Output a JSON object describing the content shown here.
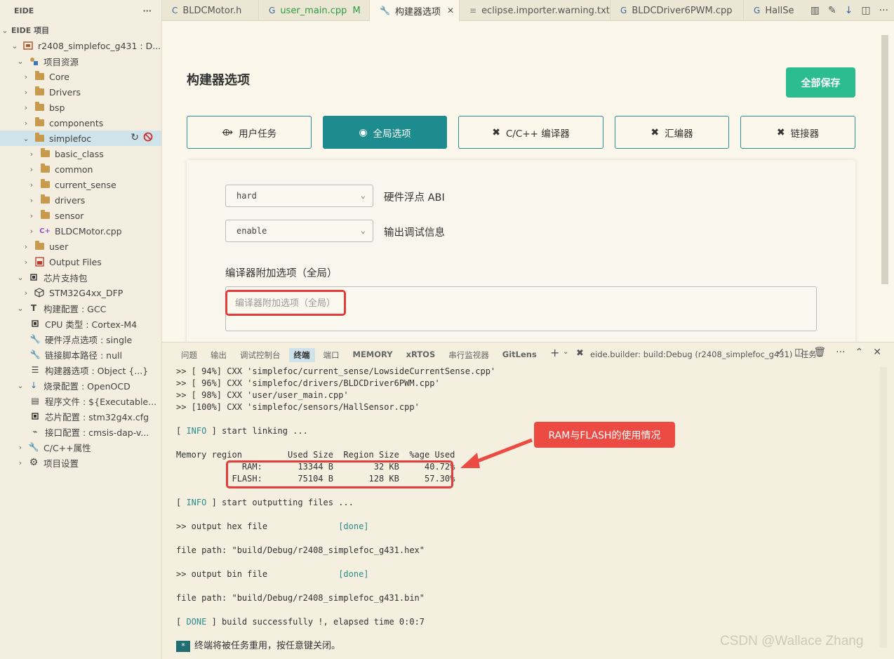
{
  "sidebar": {
    "title": "EIDE",
    "more": "···",
    "section": "EIDE 项目",
    "project_name": "r2408_simplefoc_g431 : D...",
    "resources": "项目资源",
    "folders": [
      "Core",
      "Drivers",
      "bsp",
      "components"
    ],
    "simplefoc": "simplefoc",
    "simplefoc_children": [
      "basic_class",
      "common",
      "current_sense",
      "drivers",
      "sensor"
    ],
    "bldc_file": "BLDCMotor.cpp",
    "user": "user",
    "output_files": "Output Files",
    "chip_pkg": "芯片支持包",
    "dfp": "STM32G4xx_DFP",
    "build_config": "构建配置 : GCC",
    "cpu_type": "CPU 类型 : Cortex-M4",
    "fpu": "硬件浮点选项 : single",
    "linker_script": "链接脚本路径 : null",
    "builder_options": "构建器选项 : Object {...}",
    "flash_config": "烧录配置 : OpenOCD",
    "program_file": "程序文件 : ${Executable...",
    "chip_config": "芯片配置 : stm32g4x.cfg",
    "interface_config": "接口配置 : cmsis-dap-v...",
    "cpp_props": "C/C++属性",
    "project_settings": "项目设置"
  },
  "tabs": [
    {
      "label": "BLDCMotor.h",
      "icon": "C",
      "active": false
    },
    {
      "label": "user_main.cpp",
      "icon": "G",
      "mod": "M",
      "active": false
    },
    {
      "label": "构建器选项",
      "icon": "wrench",
      "close": "✕",
      "active": true
    },
    {
      "label": "eclipse.importer.warning.txt",
      "icon": "≡",
      "active": false
    },
    {
      "label": "BLDCDriver6PWM.cpp",
      "icon": "G",
      "active": false
    },
    {
      "label": "HallSe",
      "icon": "G",
      "active": false
    }
  ],
  "editor": {
    "title": "构建器选项",
    "save_all": "全部保存",
    "buttons": [
      "用户任务",
      "全局选项",
      "C/C++ 编译器",
      "汇编器",
      "链接器"
    ],
    "float_abi_value": "hard",
    "float_abi_label": "硬件浮点 ABI",
    "debug_info_value": "enable",
    "debug_info_label": "输出调试信息",
    "extra_options_label": "编译器附加选项（全局）",
    "extra_options_placeholder": "编译器附加选项（全局）"
  },
  "panel": {
    "tabs": [
      "问题",
      "输出",
      "调试控制台",
      "终端",
      "端口",
      "MEMORY",
      "xRTOS",
      "串行监视器",
      "GitLens"
    ],
    "active_tab": "终端",
    "task": "eide.builder: build:Debug (r2408_simplefoc_g431) - 任务",
    "lines": [
      ">> [ 94%] CXX 'simplefoc/current_sense/LowsideCurrentSense.cpp'",
      ">> [ 96%] CXX 'simplefoc/drivers/BLDCDriver6PWM.cpp'",
      ">> [ 98%] CXX 'user/user_main.cpp'",
      ">> [100%] CXX 'simplefoc/sensors/HallSensor.cpp'",
      "",
      "[ INFO ] start linking ...",
      "",
      "Memory region         Used Size  Region Size  %age Used",
      "             RAM:       13344 B        32 KB     40.72%",
      "           FLASH:       75104 B       128 KB     57.30%",
      "",
      "[ INFO ] start outputting files ...",
      "",
      ">> output hex file              [done]",
      "",
      "file path: \"build/Debug/r2408_simplefoc_g431.hex\"",
      "",
      ">> output bin file              [done]",
      "",
      "file path: \"build/Debug/r2408_simplefoc_g431.bin\"",
      "",
      "[ DONE ] build successfully !, elapsed time 0:0:7",
      ""
    ],
    "final_line": "终端将被任务重用，按任意键关闭。",
    "cursor": "*"
  },
  "annotation": {
    "callout": "RAM与FLASH的使用情况",
    "color": "#ec4b43"
  },
  "watermark": "CSDN @Wallace Zhang"
}
